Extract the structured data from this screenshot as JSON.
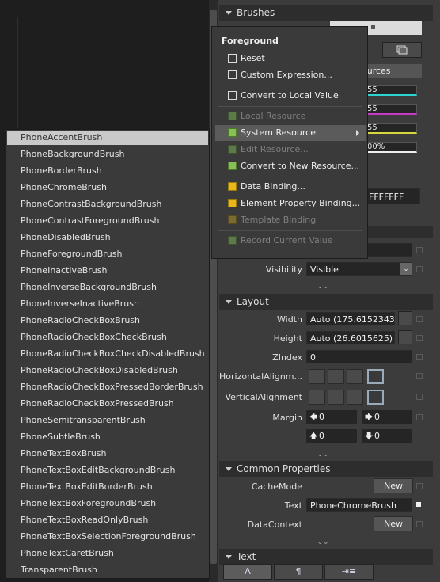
{
  "panel": {
    "brushes_header": "Brushes",
    "resources_tab_partial": "ources",
    "slider_values": [
      "55",
      "55",
      "55",
      "00%"
    ],
    "hex_value_partial": "FFFFFFF",
    "visibility": {
      "label": "Visibility",
      "value": "Visible"
    },
    "layout": {
      "header": "Layout",
      "width": {
        "label": "Width",
        "value": "Auto (175.6152343..."
      },
      "height": {
        "label": "Height",
        "value": "Auto (26.6015625)"
      },
      "zindex": {
        "label": "ZIndex",
        "value": "0"
      },
      "halign": {
        "label": "HorizontalAlignm..."
      },
      "valign": {
        "label": "VerticalAlignment"
      },
      "margin": {
        "label": "Margin",
        "left": "0",
        "right": "0",
        "top": "0",
        "bottom": "0"
      }
    },
    "common": {
      "header": "Common Properties",
      "cachemode": {
        "label": "CacheMode",
        "button": "New"
      },
      "text": {
        "label": "Text",
        "value": "PhoneChromeBrush"
      },
      "datacontext": {
        "label": "DataContext",
        "button": "New"
      }
    },
    "text_section": {
      "header": "Text"
    }
  },
  "context_menu": {
    "title": "Foreground",
    "items": [
      {
        "label": "Reset"
      },
      {
        "label": "Custom Expression..."
      },
      {
        "label": "Convert to Local Value"
      },
      {
        "label": "Local Resource"
      },
      {
        "label": "System Resource"
      },
      {
        "label": "Edit Resource..."
      },
      {
        "label": "Convert to New Resource..."
      },
      {
        "label": "Data Binding..."
      },
      {
        "label": "Element Property Binding..."
      },
      {
        "label": "Template Binding"
      },
      {
        "label": "Record Current Value"
      }
    ]
  },
  "brush_list": [
    "PhoneAccentBrush",
    "PhoneBackgroundBrush",
    "PhoneBorderBrush",
    "PhoneChromeBrush",
    "PhoneContrastBackgroundBrush",
    "PhoneContrastForegroundBrush",
    "PhoneDisabledBrush",
    "PhoneForegroundBrush",
    "PhoneInactiveBrush",
    "PhoneInverseBackgroundBrush",
    "PhoneInverseInactiveBrush",
    "PhoneRadioCheckBoxBrush",
    "PhoneRadioCheckBoxCheckBrush",
    "PhoneRadioCheckBoxCheckDisabledBrush",
    "PhoneRadioCheckBoxDisabledBrush",
    "PhoneRadioCheckBoxPressedBorderBrush",
    "PhoneRadioCheckBoxPressedBrush",
    "PhoneSemitransparentBrush",
    "PhoneSubtleBrush",
    "PhoneTextBoxBrush",
    "PhoneTextBoxEditBackgroundBrush",
    "PhoneTextBoxEditBorderBrush",
    "PhoneTextBoxForegroundBrush",
    "PhoneTextBoxReadOnlyBrush",
    "PhoneTextBoxSelectionForegroundBrush",
    "PhoneTextCaretBrush",
    "TransparentBrush"
  ]
}
